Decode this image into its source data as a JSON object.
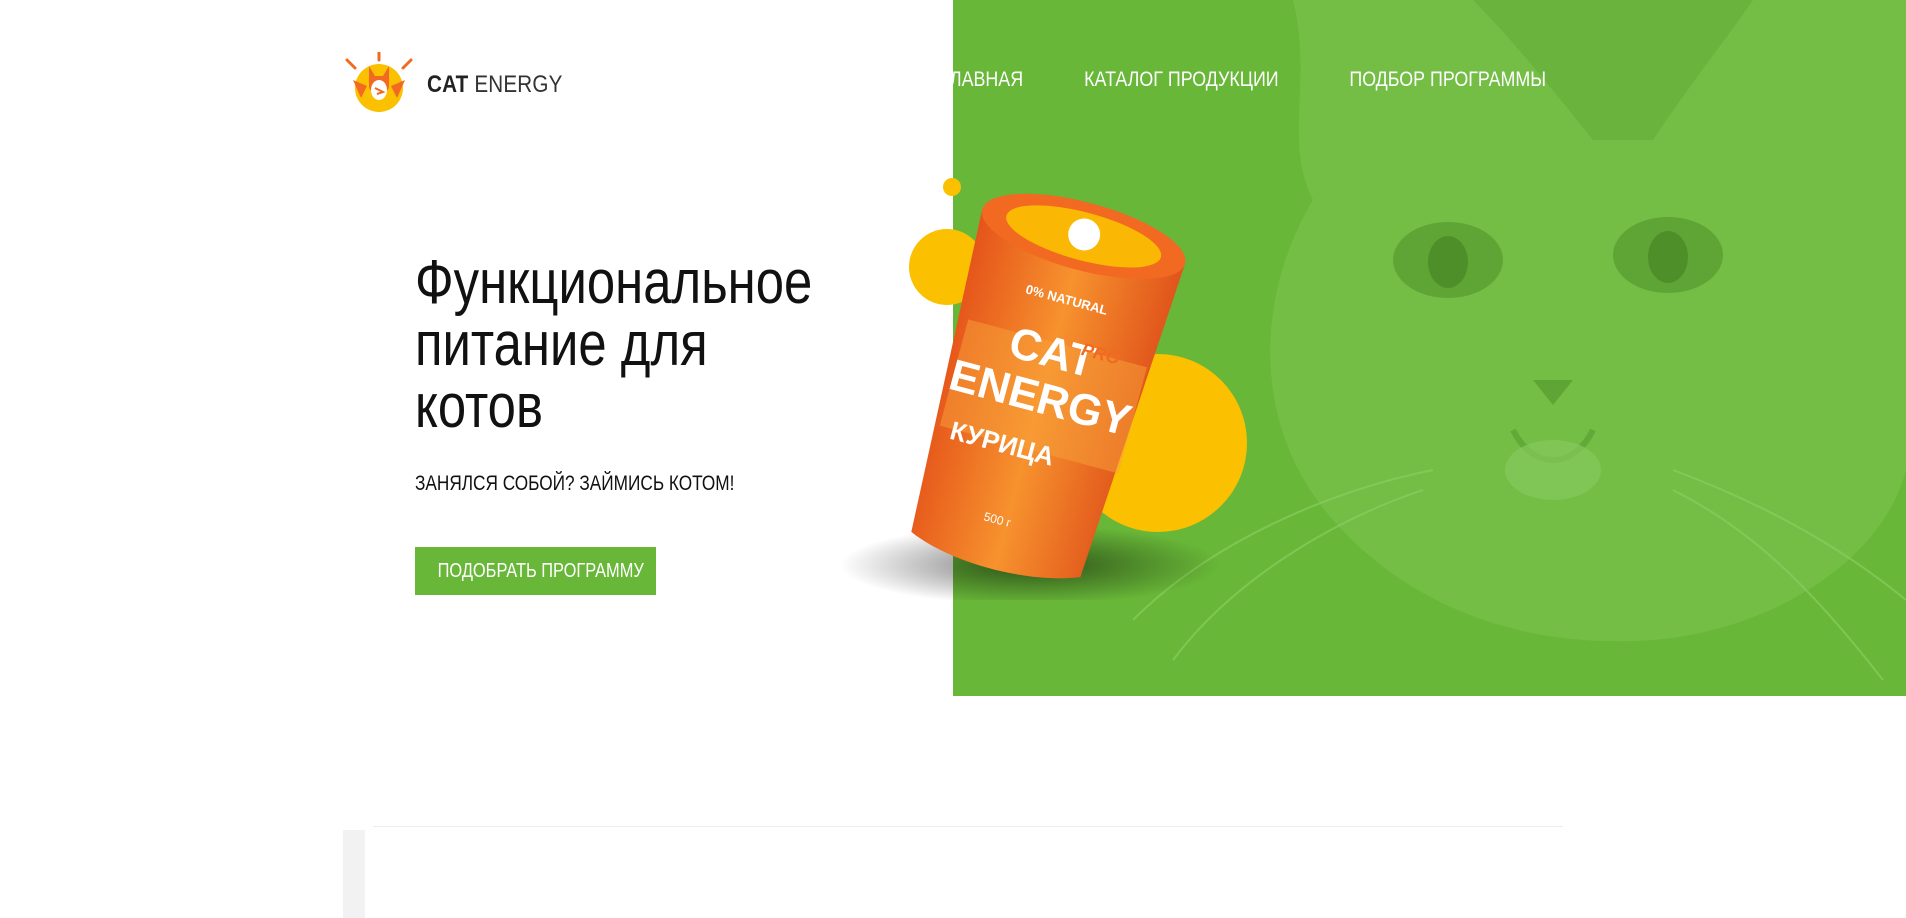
{
  "brand": {
    "name_bold": "CAT",
    "name_light": "ENERGY"
  },
  "nav": {
    "items": [
      {
        "label": "Главная"
      },
      {
        "label": "Каталог продукции"
      },
      {
        "label": "Подбор программы"
      }
    ]
  },
  "hero": {
    "title": "Функциональное питание для котов",
    "subtitle": "Занялся собой? Займись котом!",
    "button_label": "Подобрать программу"
  },
  "product": {
    "brand_line1": "CAT",
    "brand_line2": "ENERGY",
    "badge": "PRO",
    "flavor": "КУРИЦА",
    "natural_label": "0% NATURAL",
    "weight": "500 г"
  },
  "colors": {
    "accent_green": "#68b738",
    "accent_orange": "#f26a21",
    "accent_yellow": "#fbc000"
  }
}
